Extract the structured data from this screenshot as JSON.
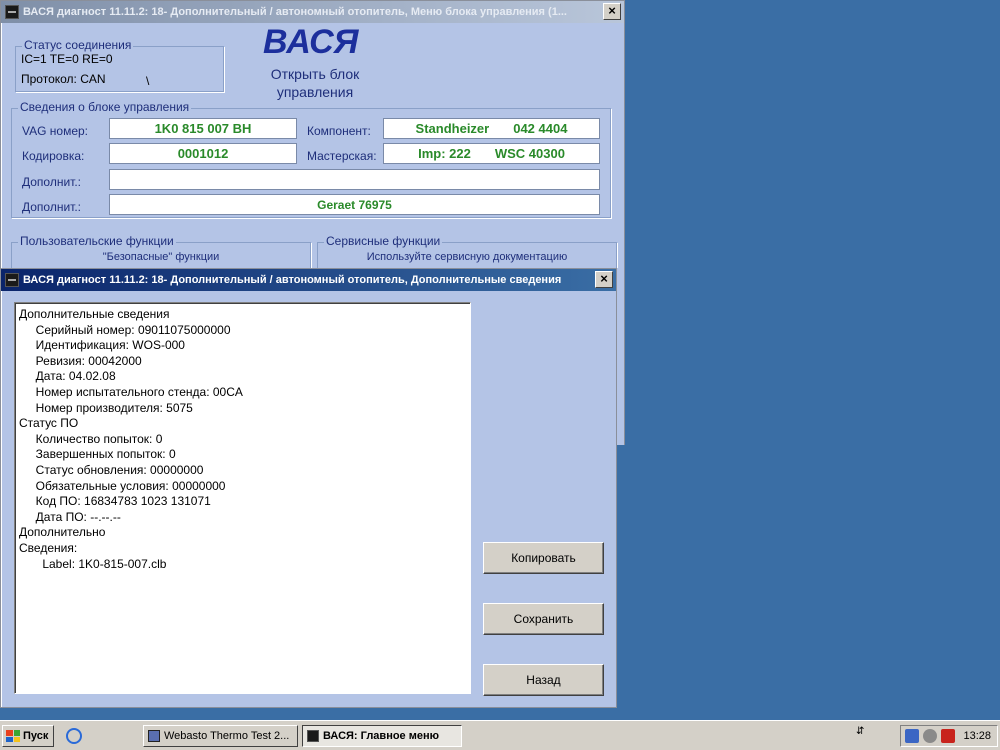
{
  "main_window": {
    "title": "ВАСЯ диагност 11.11.2: 18- Дополнительный / автономный отопитель,  Меню блока управления (1...",
    "close": "×",
    "brand": "ВАСЯ",
    "subtitle_line1": "Открыть блок",
    "subtitle_line2": "управления",
    "connection": {
      "legend": "Статус соединения",
      "status": "IC=1  TE=0   RE=0",
      "protocol": "Протокол: CAN",
      "spinner": "\\"
    },
    "unit_info": {
      "legend": "Сведения о блоке управления",
      "vag_label": "VAG номер:",
      "vag_value": "1K0 815 007 BH",
      "component_label": "Компонент:",
      "component_value_1": "Standheizer",
      "component_value_2": "042 4404",
      "coding_label": "Кодировка:",
      "coding_value": "0001012",
      "workshop_label": "Мастерская:",
      "workshop_imp": "Imp: 222",
      "workshop_wsc": "WSC 40300",
      "extra1_label": "Дополнит.:",
      "extra1_value": "",
      "extra2_label": "Дополнит.:",
      "extra2_value": "Geraet 76975"
    },
    "user_functions": {
      "legend": "Пользовательские функции",
      "note": "\"Безопасные\" функции"
    },
    "service_functions": {
      "legend": "Сервисные функции",
      "note": "Используйте сервисную документацию"
    }
  },
  "dialog": {
    "title": "ВАСЯ диагност 11.11.2: 18- Дополнительный / автономный отопитель,  Дополнительные сведения",
    "close": "×",
    "lines": [
      "Дополнительные сведения",
      "     Серийный номер: 09011075000000",
      "     Идентификация: WOS-000",
      "     Ревизия: 00042000",
      "     Дата: 04.02.08",
      "     Номер испытательного стенда: 00CA",
      "     Номер производителя: 5075",
      "Статус ПО",
      "     Количество попыток: 0",
      "     Завершенных попыток: 0",
      "     Статус обновления: 00000000",
      "     Обязательные условия: 00000000",
      "     Код ПО: 16834783 1023 131071",
      "     Дата ПО: --.--.--",
      "Дополнительно",
      "Сведения:",
      "       Label: 1K0-815-007.clb"
    ],
    "copy_button": "Копировать",
    "save_button": "Сохранить",
    "back_button": "Назад"
  },
  "taskbar": {
    "start": "Пуск",
    "task1": "Webasto Thermo Test 2...",
    "task2": "ВАСЯ:  Главное меню",
    "clock": "13:28"
  },
  "colors": {
    "desktop": "#3a6ea5",
    "window_bg": "#b4c4e6",
    "label_blue": "#1e2e7a",
    "value_green": "#2a8a2a",
    "brand_blue": "#1c2f9c"
  }
}
